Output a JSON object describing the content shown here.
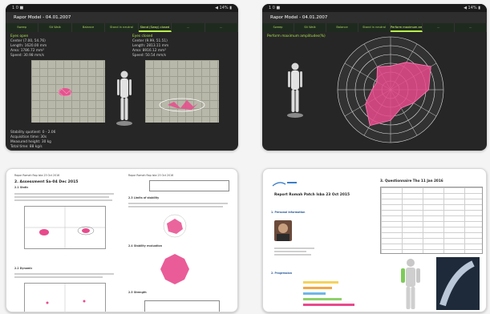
{
  "app": {
    "title": "Rapor Model - 04.01.2007",
    "status_left": "1 0 ■",
    "status_right": "◀ 14% ▮"
  },
  "tabs_a": [
    "Sweep",
    "Sit Walk",
    "Balance",
    "Stand in neutral",
    "Stand (Sway) closed",
    "...",
    "..."
  ],
  "tabs_b": [
    "Sweep",
    "Sit Walk",
    "Balance",
    "Stand in neutral",
    "Perform maximum amplitudes",
    "...",
    "..."
  ],
  "panel_a": {
    "eyes_open_title": "Eyes open",
    "eyes_open_lines": [
      "Center (7.00, 54.76)",
      "Length: 1620.00 mm",
      "Area: 1786.72 mm²",
      "Speed: 30.98 mm/s"
    ],
    "eyes_closed_title": "Eyes closed",
    "eyes_closed_lines": [
      "Center (9.99, 51.51)",
      "Length: 2813.11 mm",
      "Area: 8916.12 mm²",
      "Speed: 50.54 mm/s"
    ],
    "stability_lines": [
      "Stability quotient: 0 - 2.06",
      "Acquisition time: 30s",
      "Measured height: 30 kg",
      "Total time: 88 kg/s"
    ]
  },
  "panel_b": {
    "heading": "Perform maximum amplitudes(%)",
    "radar_values": [
      45,
      60,
      88,
      72,
      50,
      40,
      58,
      78,
      55,
      35,
      30,
      50
    ],
    "accent": "#e84a8c"
  },
  "doc_c": {
    "header": "Rapor Romah Rap Ista 23 Oct 2016",
    "section1": "2. Assessment Sa-04 Dec 2015",
    "sub1": "2.1 Static",
    "sub2": "2.2 Dynamic",
    "section_r": "2.3 Limits of stability",
    "sub_r2": "2.4 Stability evaluation",
    "sub_r3": "2.5 Strength"
  },
  "doc_d": {
    "report_title": "Report Romah Patch Isba 23 Oct 2015",
    "section_person": "1. Personal information",
    "section_progress": "2. Progression",
    "right_heading": "3. Questionnaire Tho 11 Jan 2016",
    "bar_colors": [
      "#f5d35a",
      "#f4a742",
      "#6fb6e8",
      "#8fd06a",
      "#e84a8c"
    ],
    "bar_values": [
      0.55,
      0.45,
      0.35,
      0.6,
      0.8
    ]
  }
}
